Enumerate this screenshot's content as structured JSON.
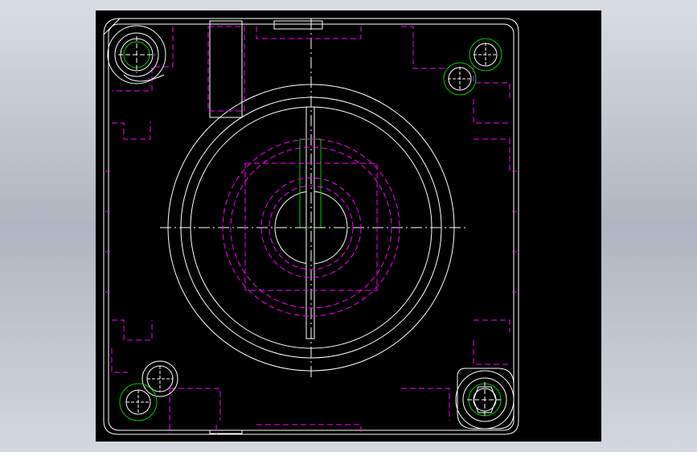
{
  "canvas": {
    "background": "#000000",
    "page_background": "#c3c9d1"
  },
  "colors": {
    "outline": "#ffffff",
    "hidden": "#ff00ff",
    "circle": "#00cc00"
  },
  "drawing": {
    "view": "top",
    "features": [
      "outer-frame",
      "center-bore",
      "concentric-rings",
      "keyway-slot",
      "corner-bolt-holes",
      "dowel-holes",
      "hidden-cutouts"
    ]
  }
}
